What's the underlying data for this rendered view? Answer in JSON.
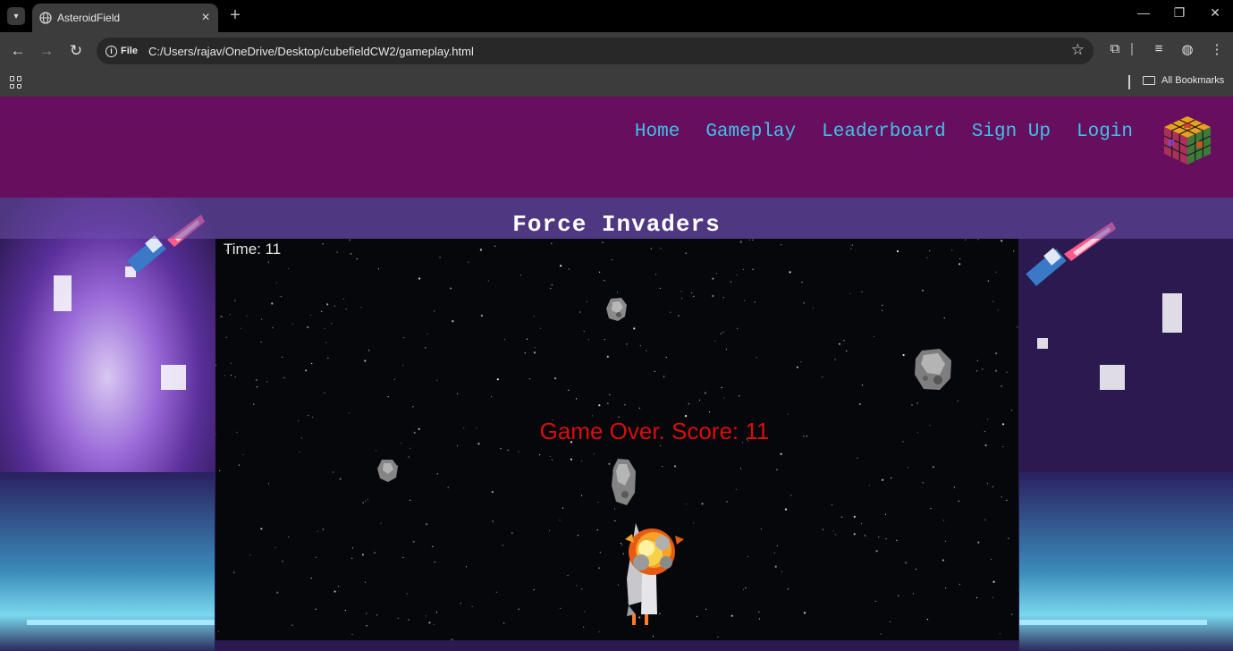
{
  "browser": {
    "tab_title": "AsteroidField",
    "new_tab_symbol": "+",
    "address_chip": "File",
    "url": "C:/Users/rajav/OneDrive/Desktop/cubefieldCW2/gameplay.html",
    "all_bookmarks": "All Bookmarks"
  },
  "site": {
    "nav": [
      "Home",
      "Gameplay",
      "Leaderboard",
      "Sign Up",
      "Login"
    ],
    "header_color": "#680e5e",
    "nav_color": "#41c0ea"
  },
  "game": {
    "title": "Force Invaders",
    "time_label": "Time: 11",
    "game_over_text": "Game Over. Score: 11",
    "score": 11,
    "time": 11
  }
}
